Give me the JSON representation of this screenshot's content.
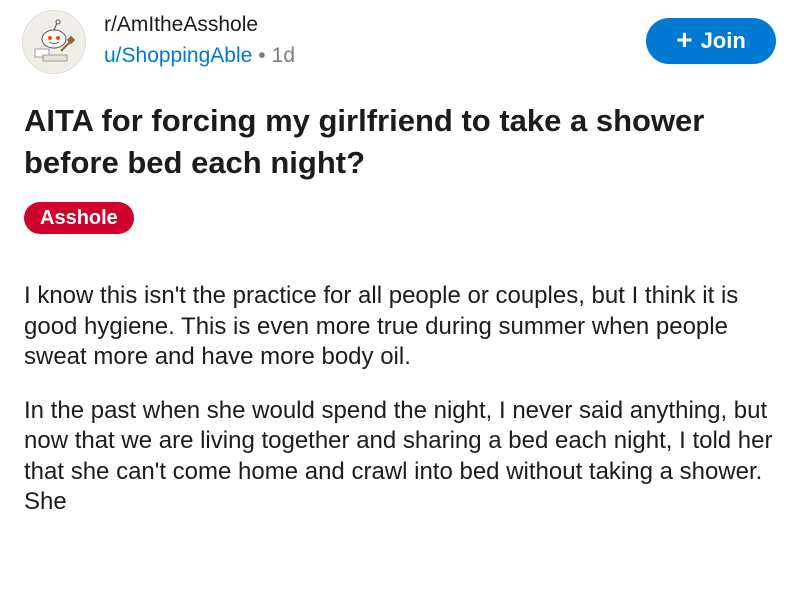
{
  "post": {
    "subreddit": "r/AmItheAsshole",
    "username": "u/ShoppingAble",
    "separator": "•",
    "age": "1d",
    "join_label": "Join",
    "title": "AITA for forcing my girlfriend to take a shower before bed each night?",
    "flair": "Asshole",
    "flair_color": "#d0022b",
    "accent_color": "#0079d3",
    "paragraphs": [
      "I know this isn't the practice for all people or couples, but I think it is good hygiene. This is even more true during summer when people sweat more and have more body oil.",
      "In the past when she would spend the night, I never said anything, but now that we are living together and sharing a bed each night, I told her that she can't come home and crawl into bed without taking a shower. She"
    ],
    "avatar_icon": "snoo-judge-icon"
  }
}
